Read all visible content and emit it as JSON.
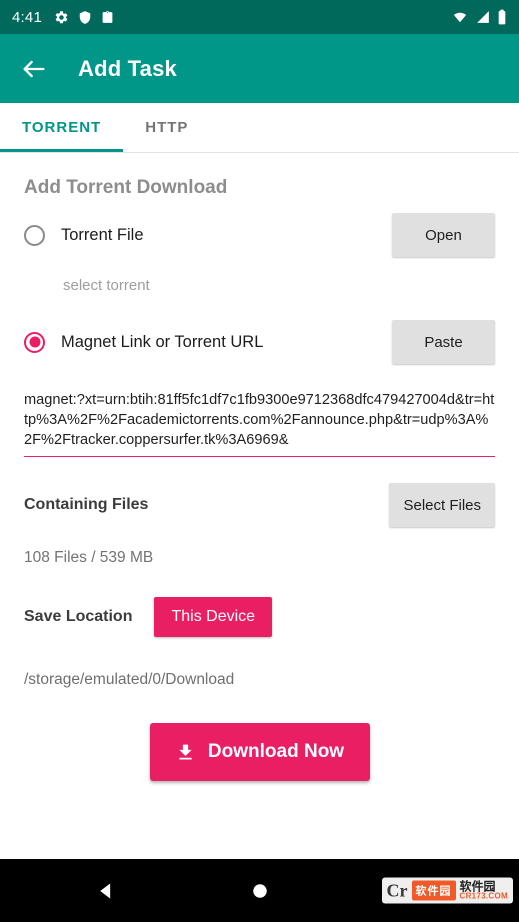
{
  "statusbar": {
    "time": "4:41",
    "left_icons": [
      "gear-icon",
      "shield-icon",
      "clipboard-icon"
    ],
    "right_icons": [
      "wifi-icon",
      "signal-icon",
      "battery-icon"
    ]
  },
  "appbar": {
    "back_icon": "arrow-left-icon",
    "title": "Add Task"
  },
  "tabs": [
    {
      "label": "TORRENT",
      "active": true
    },
    {
      "label": "HTTP",
      "active": false
    }
  ],
  "main": {
    "section_title": "Add Torrent Download",
    "torrent_file": {
      "label": "Torrent File",
      "selected": false,
      "button": "Open",
      "hint": "select torrent"
    },
    "magnet": {
      "label": "Magnet Link or Torrent URL",
      "selected": true,
      "button": "Paste",
      "value": "magnet:?xt=urn:btih:81ff5fc1df7c1fb9300e9712368dfc479427004d&tr=http%3A%2F%2Facademictorrents.com%2Fannounce.php&tr=udp%3A%2F%2Ftracker.coppersurfer.tk%3A6969&"
    },
    "containing_files": {
      "label": "Containing Files",
      "button": "Select Files",
      "info": "108 Files / 539 MB"
    },
    "save_location": {
      "label": "Save Location",
      "button": "This Device",
      "path": "/storage/emulated/0/Download"
    },
    "download_button": {
      "label": "Download Now",
      "icon": "download-icon"
    }
  },
  "navbar": {
    "back": "nav-back-triangle-icon",
    "home": "nav-home-circle-icon",
    "watermark": {
      "cr": "Cr",
      "mid": "软件园",
      "line1": "软件园",
      "line2": "CR173.COM"
    }
  },
  "colors": {
    "status_bar": "#00695c",
    "app_bar": "#009688",
    "accent_teal": "#009688",
    "accent_pink": "#e91e63"
  }
}
